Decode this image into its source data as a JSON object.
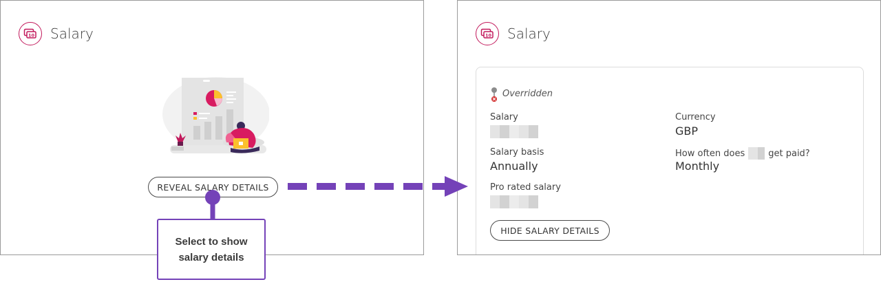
{
  "left_panel": {
    "title": "Salary",
    "reveal_button_label": "REVEAL SALARY DETAILS"
  },
  "right_panel": {
    "title": "Salary",
    "override_status": "Overridden",
    "fields": {
      "salary_label": "Salary",
      "currency_label": "Currency",
      "currency_value": "GBP",
      "salary_basis_label": "Salary basis",
      "salary_basis_value": "Annually",
      "pay_frequency_label_prefix": "How often does",
      "pay_frequency_label_suffix": "get paid?",
      "pay_frequency_value": "Monthly",
      "pro_rated_salary_label": "Pro rated salary"
    },
    "hide_button_label": "HIDE SALARY DETAILS"
  },
  "callout": {
    "line1": "Select to show",
    "line2": "salary details"
  },
  "colors": {
    "accent_purple": "#7442b8",
    "brand_magenta": "#c2185b",
    "border_grey": "#9a9a9a"
  },
  "icons": [
    "salary-money-icon",
    "override-pin-icon",
    "salary-illustration"
  ]
}
